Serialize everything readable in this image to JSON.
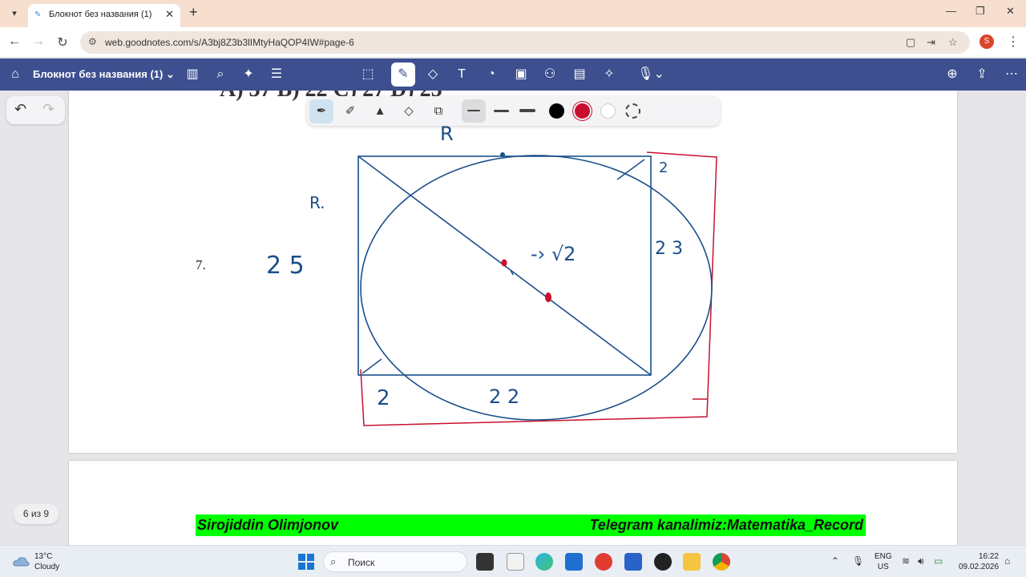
{
  "browser": {
    "tab_title": "Блокнот без названия (1)",
    "url": "web.goodnotes.com/s/A3bj8Z3b3lIMtyHaQOP4IW#page-6",
    "profile_initial": "S"
  },
  "app": {
    "notebook_title": "Блокнот без названия (1)",
    "page_indicator": "6 из 9"
  },
  "page": {
    "question_number": "7.",
    "header_fragment": "A) 37        B) 22         C) 27              D) 25"
  },
  "handwriting": {
    "r_label": "R",
    "r_dot": "R.",
    "val_25": "2 5",
    "val_2_top": "2",
    "val_23": "2 3",
    "val_sqrt2": "-› √2",
    "val_2_bottom": "2",
    "val_22": "2 2"
  },
  "banner": {
    "author": "Sirojiddin Olimjonov",
    "channel": "Telegram kanalimiz:Matematika_Record"
  },
  "pen_palette": {
    "colors": [
      "#000000",
      "#c8102e",
      "#ffffff"
    ]
  },
  "taskbar": {
    "temperature": "13°C",
    "weather": "Cloudy",
    "search_placeholder": "Поиск",
    "lang_top": "ENG",
    "lang_bottom": "US",
    "time": "16:22",
    "date": "09.02.2026"
  },
  "colors": {
    "toolbar": "#3d4f8e",
    "ink_blue": "#1a4f8a",
    "ink_red": "#c8102e",
    "banner": "#00ff00"
  }
}
